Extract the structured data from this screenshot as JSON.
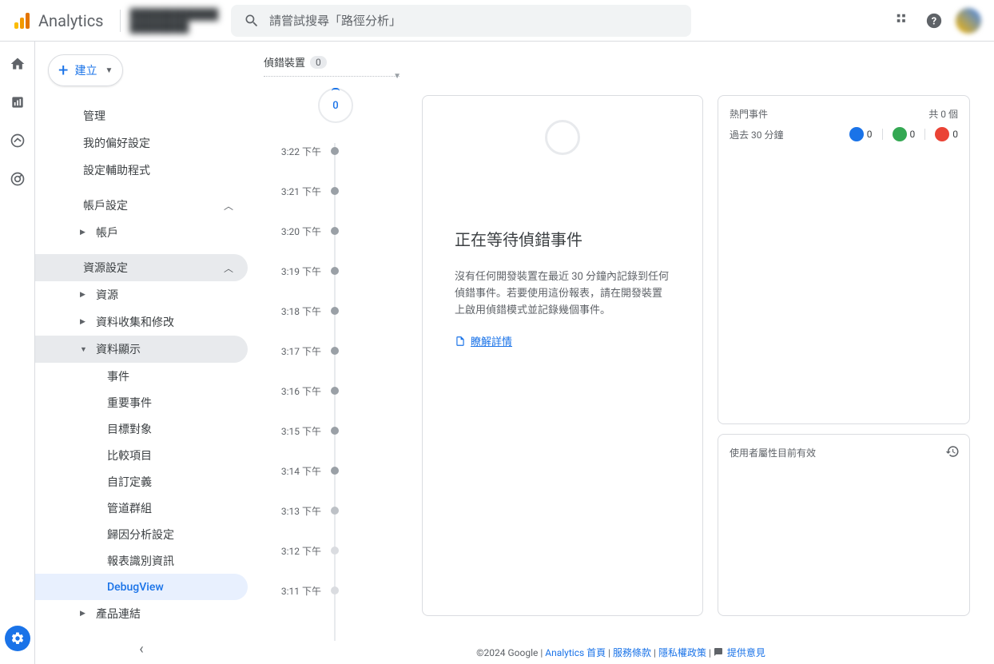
{
  "header": {
    "brand": "Analytics",
    "search_placeholder": "請嘗試搜尋「路徑分析」"
  },
  "sidebar": {
    "create_label": "建立",
    "items": {
      "manage": "管理",
      "prefs": "我的偏好設定",
      "setup_assist": "設定輔助程式",
      "account_settings": "帳戶設定",
      "account": "帳戶",
      "property_settings": "資源設定",
      "property": "資源",
      "data_collection": "資料收集和修改",
      "data_display": "資料顯示",
      "events": "事件",
      "key_events": "重要事件",
      "audiences": "目標對象",
      "comparisons": "比較項目",
      "custom_def": "自訂定義",
      "channel_groups": "管道群組",
      "attribution": "歸因分析設定",
      "reporting_identity": "報表識別資訊",
      "debugview": "DebugView",
      "product_links": "產品連結"
    }
  },
  "main": {
    "debug_device_label": "偵錯裝置",
    "debug_device_count": "0",
    "bubble_count": "0",
    "timeline": [
      "3:22 下午",
      "3:21 下午",
      "3:20 下午",
      "3:19 下午",
      "3:18 下午",
      "3:17 下午",
      "3:16 下午",
      "3:15 下午",
      "3:14 下午",
      "3:13 下午",
      "3:12 下午",
      "3:11 下午"
    ],
    "waiting_title": "正在等待偵錯事件",
    "waiting_desc": "沒有任何開發裝置在最近 30 分鐘內記錄到任何偵錯事件。若要使用這份報表，請在開發裝置上啟用偵錯模式並記錄幾個事件。",
    "learn_more": "瞭解詳情"
  },
  "right": {
    "top_events_title": "熱門事件",
    "total_label": "共 0 個",
    "last_30": "過去 30 分鐘",
    "counts": {
      "blue": "0",
      "green": "0",
      "red": "0"
    },
    "user_props_title": "使用者屬性目前有效"
  },
  "footer": {
    "copyright": "©2024 Google",
    "home": "Analytics 首頁",
    "tos": "服務條款",
    "privacy": "隱私權政策",
    "feedback": "提供意見"
  }
}
